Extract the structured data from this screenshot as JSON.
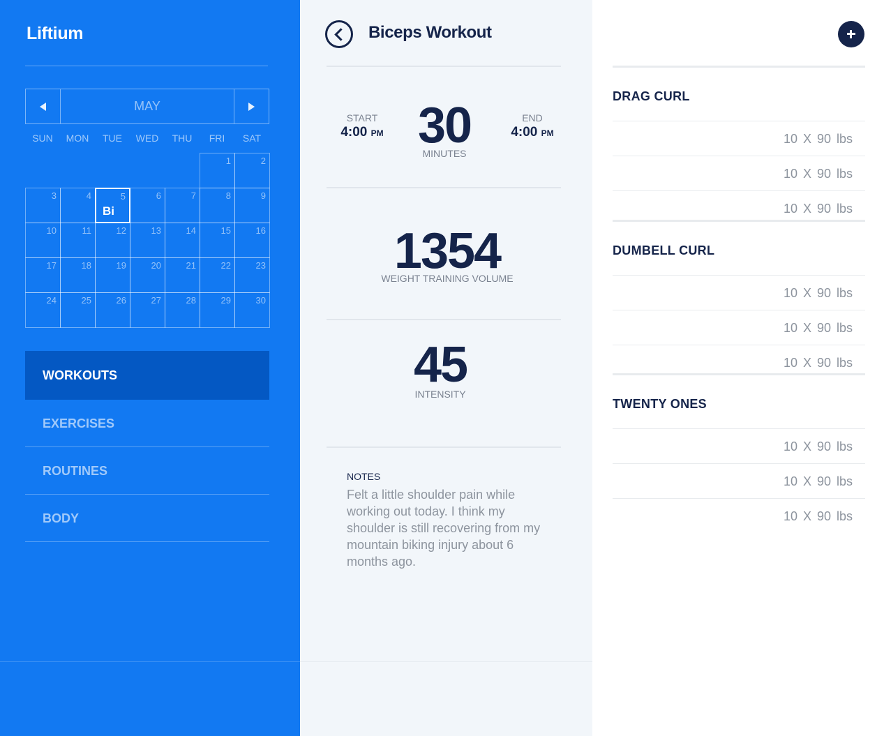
{
  "app": {
    "name": "Liftium"
  },
  "calendar": {
    "month": "MAY",
    "weekdays": [
      "SUN",
      "MON",
      "TUE",
      "WED",
      "THU",
      "FRI",
      "SAT"
    ],
    "days": [
      {
        "num": "1",
        "col": 5,
        "row": 0
      },
      {
        "num": "2",
        "col": 6,
        "row": 0
      },
      {
        "num": "3",
        "col": 0,
        "row": 1
      },
      {
        "num": "4",
        "col": 1,
        "row": 1
      },
      {
        "num": "5",
        "col": 2,
        "row": 1,
        "selected": true,
        "label": "Bi"
      },
      {
        "num": "6",
        "col": 3,
        "row": 1
      },
      {
        "num": "7",
        "col": 4,
        "row": 1
      },
      {
        "num": "8",
        "col": 5,
        "row": 1
      },
      {
        "num": "9",
        "col": 6,
        "row": 1
      },
      {
        "num": "10",
        "col": 0,
        "row": 2
      },
      {
        "num": "11",
        "col": 1,
        "row": 2
      },
      {
        "num": "12",
        "col": 2,
        "row": 2
      },
      {
        "num": "13",
        "col": 3,
        "row": 2
      },
      {
        "num": "14",
        "col": 4,
        "row": 2
      },
      {
        "num": "15",
        "col": 5,
        "row": 2
      },
      {
        "num": "16",
        "col": 6,
        "row": 2
      },
      {
        "num": "17",
        "col": 0,
        "row": 3
      },
      {
        "num": "18",
        "col": 1,
        "row": 3
      },
      {
        "num": "19",
        "col": 2,
        "row": 3
      },
      {
        "num": "20",
        "col": 3,
        "row": 3
      },
      {
        "num": "21",
        "col": 4,
        "row": 3
      },
      {
        "num": "22",
        "col": 5,
        "row": 3
      },
      {
        "num": "23",
        "col": 6,
        "row": 3
      },
      {
        "num": "24",
        "col": 0,
        "row": 4
      },
      {
        "num": "25",
        "col": 1,
        "row": 4
      },
      {
        "num": "26",
        "col": 2,
        "row": 4
      },
      {
        "num": "27",
        "col": 3,
        "row": 4
      },
      {
        "num": "28",
        "col": 4,
        "row": 4
      },
      {
        "num": "29",
        "col": 5,
        "row": 4
      },
      {
        "num": "30",
        "col": 6,
        "row": 4
      }
    ]
  },
  "nav": {
    "items": [
      {
        "label": "WORKOUTS",
        "active": true
      },
      {
        "label": "EXERCISES"
      },
      {
        "label": "ROUTINES"
      },
      {
        "label": "BODY"
      }
    ]
  },
  "workout": {
    "title": "Biceps Workout",
    "start_label": "START",
    "start_time": "4:00",
    "start_ampm": "PM",
    "end_label": "END",
    "end_time": "4:00",
    "end_ampm": "PM",
    "duration": "30",
    "duration_label": "MINUTES",
    "volume": "1354",
    "volume_label": "WEIGHT TRAINING VOLUME",
    "intensity": "45",
    "intensity_label": "INTENSITY",
    "notes_label": "NOTES",
    "notes": "Felt a little shoulder pain while working out today. I think my shoulder is still recovering from my mountain biking injury about 6 months ago."
  },
  "exercises": [
    {
      "name": "DRAG CURL",
      "sets": [
        "10  X  90 lbs",
        "10  X  90 lbs",
        "10  X  90 lbs"
      ]
    },
    {
      "name": "DUMBELL CURL",
      "sets": [
        "10  X  90 lbs",
        "10  X  90 lbs",
        "10  X  90 lbs"
      ]
    },
    {
      "name": "TWENTY ONES",
      "sets": [
        "10  X  90 lbs",
        "10  X  90 lbs",
        "10  X  90 lbs"
      ]
    }
  ]
}
